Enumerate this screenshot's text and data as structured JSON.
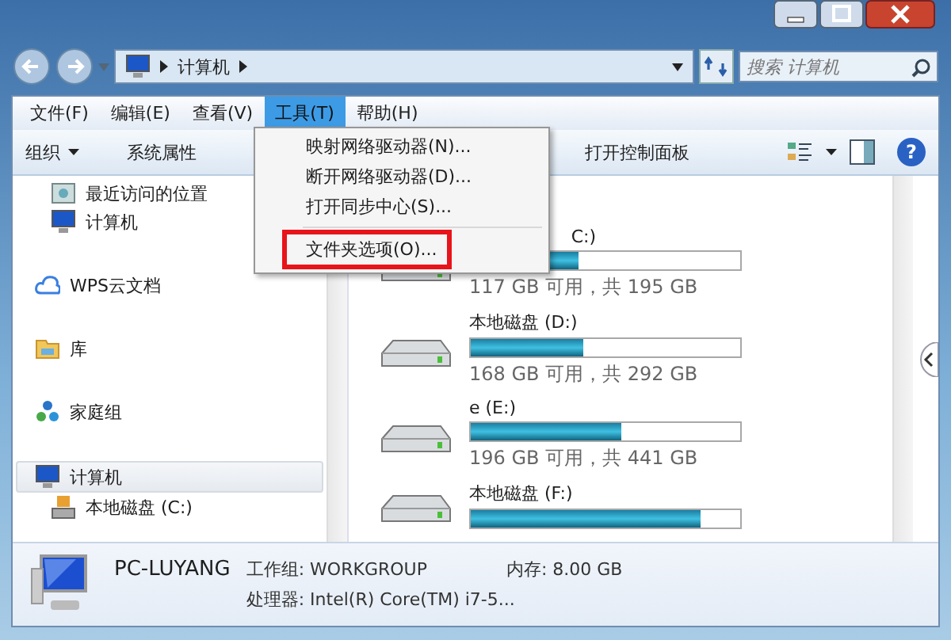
{
  "address": {
    "path": "计算机",
    "search_placeholder": "搜索 计算机"
  },
  "menu_bar": [
    {
      "label": "文件(F)",
      "selected": false
    },
    {
      "label": "编辑(E)",
      "selected": false
    },
    {
      "label": "查看(V)",
      "selected": false
    },
    {
      "label": "工具(T)",
      "selected": true
    },
    {
      "label": "帮助(H)",
      "selected": false
    }
  ],
  "toolbar": {
    "items": [
      "组织",
      "系统属性",
      "打开控制面板"
    ],
    "help": "?"
  },
  "dropdown": {
    "items": [
      {
        "label": "映射网络驱动器(N)...",
        "highlighted": false
      },
      {
        "label": "断开网络驱动器(D)...",
        "highlighted": false
      },
      {
        "label": "打开同步中心(S)...",
        "highlighted": false
      },
      {
        "label": "文件夹选项(O)...",
        "highlighted": true
      }
    ]
  },
  "sidebar": {
    "items": [
      {
        "label": "最近访问的位置",
        "kind": "recent",
        "indent": true
      },
      {
        "label": "计算机",
        "kind": "computer",
        "indent": true
      },
      {
        "label": "WPS云文档",
        "kind": "cloud",
        "indent": false
      },
      {
        "label": "库",
        "kind": "library",
        "indent": false
      },
      {
        "label": "家庭组",
        "kind": "homegroup",
        "indent": false
      },
      {
        "label": "计算机",
        "kind": "computer",
        "indent": false,
        "selected": true
      },
      {
        "label": "本地磁盘 (C:)",
        "kind": "drive",
        "indent": true
      }
    ]
  },
  "drives": [
    {
      "name": "C:)",
      "covered": true,
      "level": 0.4,
      "info": "117 GB 可用，共 195 GB"
    },
    {
      "name": "本地磁盘 (D:)",
      "level": 0.42,
      "info": "168 GB 可用，共 292 GB"
    },
    {
      "name": "e (E:)",
      "level": 0.56,
      "info": "196 GB 可用，共 441 GB"
    },
    {
      "name": "本地磁盘 (F:)",
      "level": 0.85
    }
  ],
  "status_bar": {
    "computer": "PC-LUYANG",
    "fields": [
      {
        "label": "工作组:",
        "value": "WORKGROUP"
      },
      {
        "label": "内存:",
        "value": "8.00 GB"
      },
      {
        "label": "处理器:",
        "value": "Intel(R) Core(TM) i7-5..."
      }
    ]
  }
}
